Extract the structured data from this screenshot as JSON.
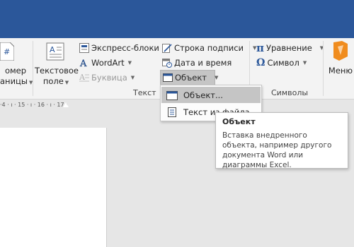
{
  "ribbon": {
    "page_number": {
      "line1": "омер",
      "line2": "аницы"
    },
    "textbox": {
      "line1": "Текстовое",
      "line2": "поле"
    },
    "quick_parts": "Экспресс-блоки",
    "wordart": "WordArt",
    "dropcap": "Буквица",
    "signature_line": "Строка подписи",
    "date_time": "Дата и время",
    "object": "Объект",
    "equation": "Уравнение",
    "symbol": "Символ",
    "menu": "Меню",
    "group_text": "Текст",
    "group_symbols": "Символы"
  },
  "ruler": {
    "ticks": "·4 · ı · 15 · ı · 16 · ı · 17 ·"
  },
  "object_menu": {
    "items": [
      {
        "label": "Объект...",
        "icon": "object-icon",
        "hover": true
      },
      {
        "label": "Текст из файла",
        "icon": "text-from-file-icon",
        "hover": false
      }
    ]
  },
  "tooltip": {
    "title": "Объект",
    "body": "Вставка внедренного объекта, например другого документа Word или диаграммы Excel."
  },
  "colors": {
    "accent": "#2b579a",
    "hover": "#c5c5c5",
    "office_orange": "#f08c1e"
  }
}
